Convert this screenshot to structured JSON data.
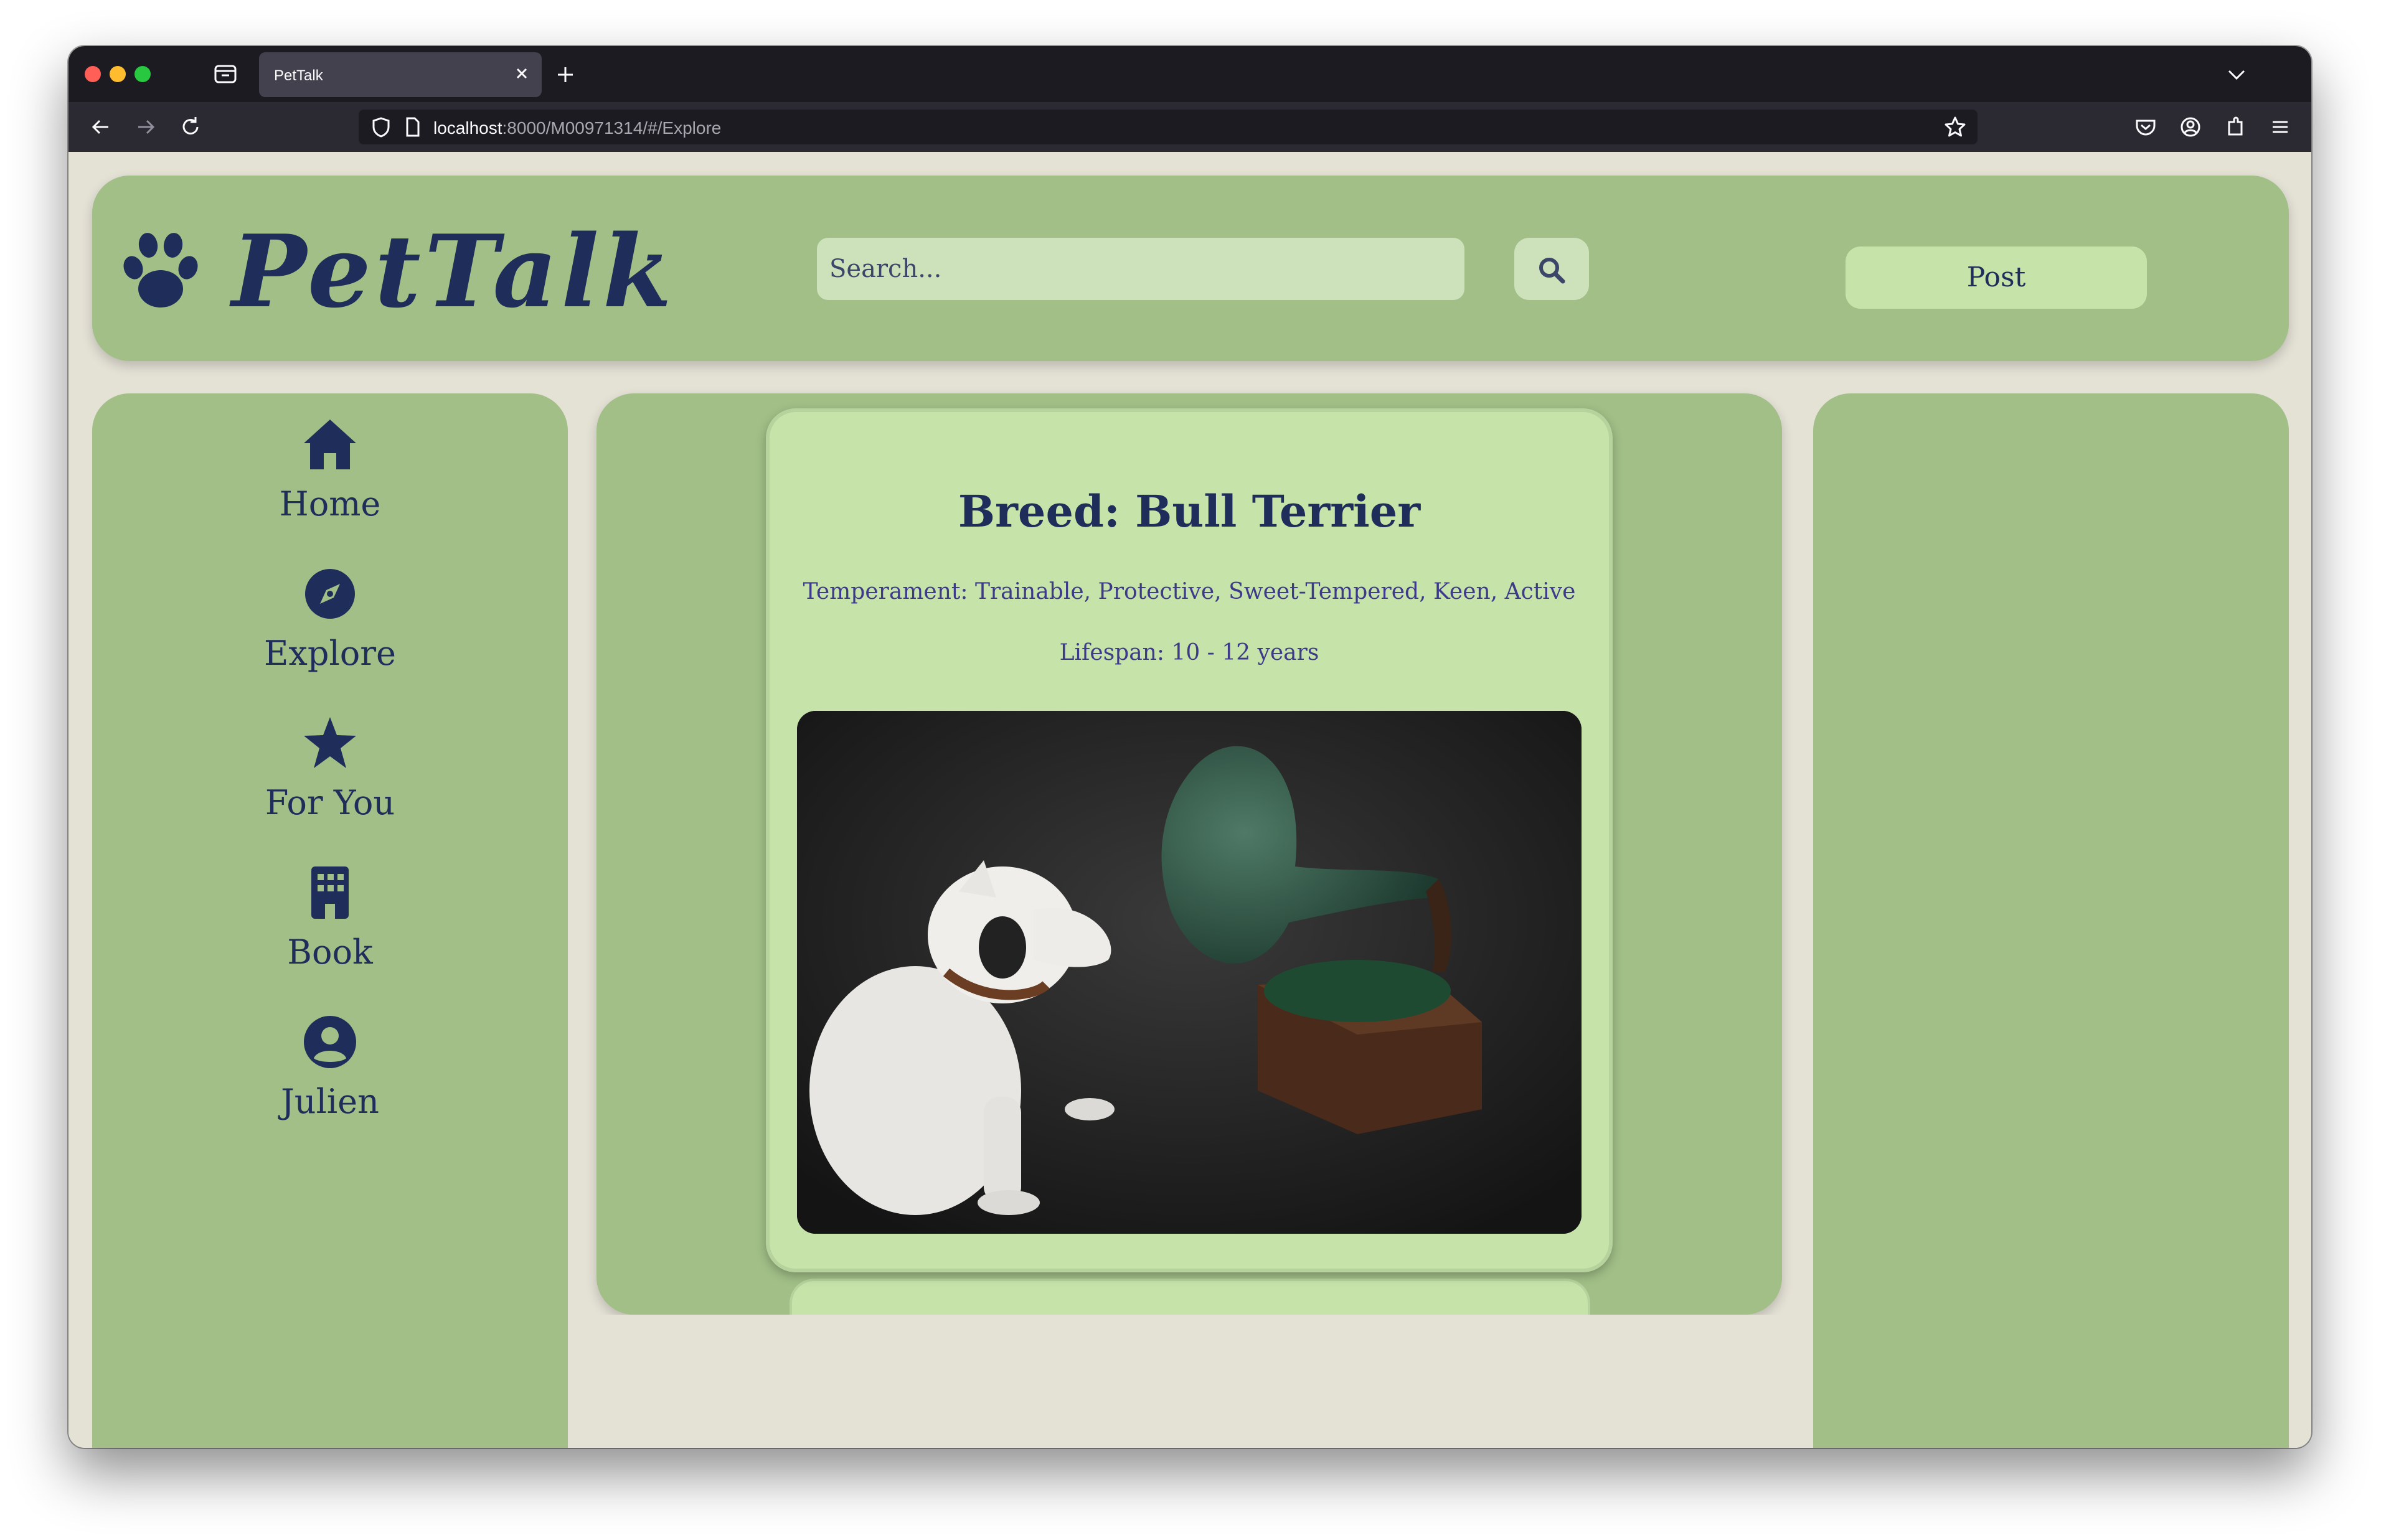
{
  "browser": {
    "tab_title": "PetTalk",
    "url_host": "localhost",
    "url_rest": ":8000/M00971314/#/Explore"
  },
  "header": {
    "logo_text": "PetTalk",
    "search_placeholder": "Search...",
    "post_label": "Post"
  },
  "sidebar": {
    "items": [
      {
        "label": "Home",
        "icon": "home-icon"
      },
      {
        "label": "Explore",
        "icon": "compass-icon"
      },
      {
        "label": "For You",
        "icon": "star-icon"
      },
      {
        "label": "Book",
        "icon": "building-icon"
      },
      {
        "label": "Julien",
        "icon": "user-icon"
      }
    ]
  },
  "feed": {
    "breed_title": "Breed: Bull Terrier",
    "temperament": "Temperament: Trainable, Protective, Sweet-Tempered, Keen, Active",
    "lifespan": "Lifespan: 10 - 12 years"
  },
  "colors": {
    "panel": "#a1bf87",
    "card": "#c6e3aa",
    "text": "#1f2d5a",
    "page_bg": "#e4e1d5"
  }
}
